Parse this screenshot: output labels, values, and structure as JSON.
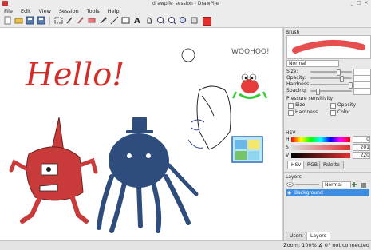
{
  "window": {
    "title": "drawpile_session - DrawPile"
  },
  "menu": [
    "File",
    "Edit",
    "View",
    "Session",
    "Tools",
    "Help"
  ],
  "canvas": {
    "text_hello": "Hello!",
    "text_woohoo": "WOOHOO!"
  },
  "brush_panel": {
    "title": "Brush",
    "blend_mode": "Normal",
    "sliders": [
      {
        "label": "Size:",
        "value": 0.64
      },
      {
        "label": "Opacity:",
        "value": 0.72
      },
      {
        "label": "Hardness:",
        "value": 0.94
      },
      {
        "label": "Spacing:",
        "value": 0.14
      }
    ],
    "pressure_title": "Pressure sensitivity",
    "pressure": [
      "Size",
      "Opacity",
      "Hardness",
      "Color"
    ]
  },
  "hsv_panel": {
    "title": "HSV",
    "rows": [
      {
        "label": "H",
        "value": "0"
      },
      {
        "label": "S",
        "value": "201"
      },
      {
        "label": "V",
        "value": "220"
      }
    ],
    "tabs": [
      "HSV",
      "RGB",
      "Palette"
    ]
  },
  "layers_panel": {
    "title": "Layers",
    "mode": "Normal",
    "layers": [
      "Background"
    ]
  },
  "bottom_tabs": [
    "Users",
    "Layers"
  ],
  "status": {
    "text": "Zoom: 100% ∡ 0° not connected"
  },
  "colors": {
    "accent": "#3d8ee0",
    "brush_red": "#e03030",
    "ink_red": "#d22d28",
    "ink_blue": "#2e4d7c"
  }
}
